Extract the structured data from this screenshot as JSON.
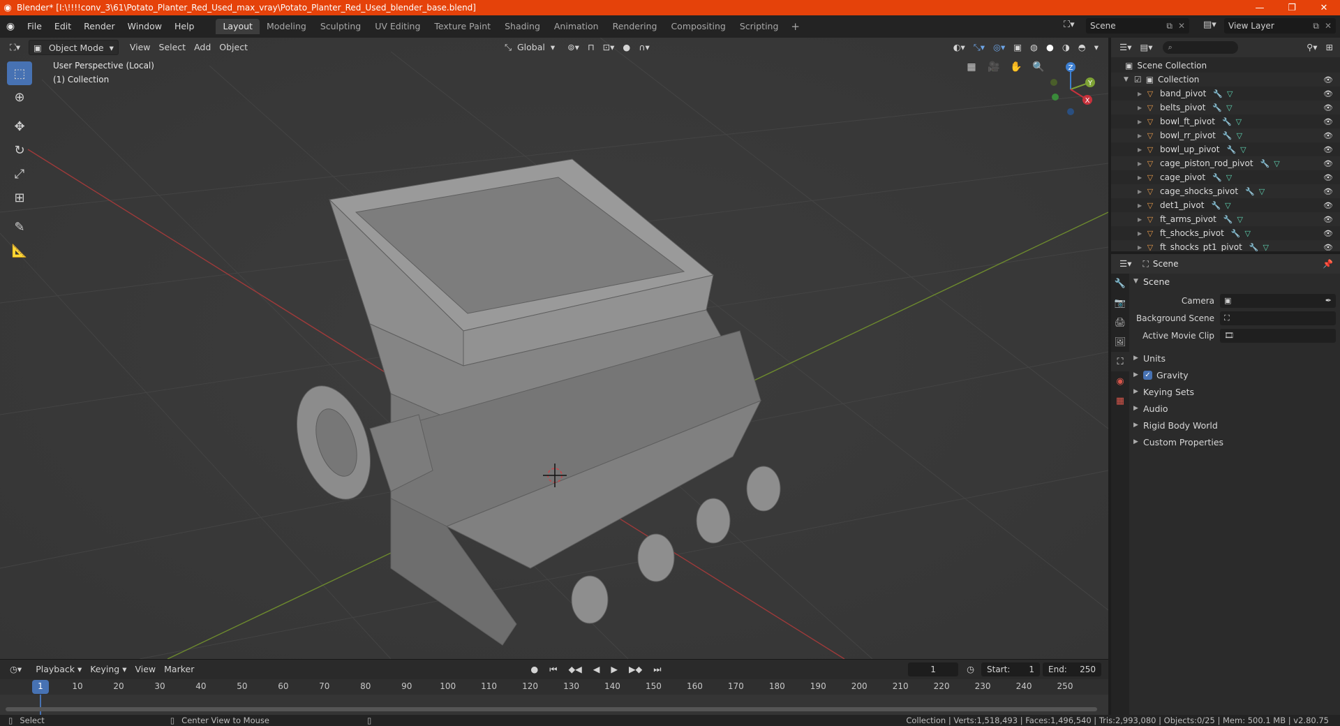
{
  "window": {
    "title": "Blender* [I:\\!!!!conv_3\\61\\Potato_Planter_Red_Used_max_vray\\Potato_Planter_Red_Used_blender_base.blend]",
    "minimize": "—",
    "maximize": "❐",
    "close": "✕"
  },
  "menu": [
    "File",
    "Edit",
    "Render",
    "Window",
    "Help"
  ],
  "workspaces": [
    "Layout",
    "Modeling",
    "Sculpting",
    "UV Editing",
    "Texture Paint",
    "Shading",
    "Animation",
    "Rendering",
    "Compositing",
    "Scripting"
  ],
  "active_workspace": "Layout",
  "scene_name": "Scene",
  "view_layer": "View Layer",
  "viewport": {
    "mode": "Object Mode",
    "menus": [
      "View",
      "Select",
      "Add",
      "Object"
    ],
    "orientation": "Global",
    "info_line1": "User Perspective (Local)",
    "info_line2": "(1) Collection",
    "gizmo": {
      "x": "X",
      "y": "Y",
      "z": "Z"
    }
  },
  "timeline": {
    "menus": [
      "Playback",
      "Keying",
      "View",
      "Marker"
    ],
    "current_frame": "1",
    "start_label": "Start:",
    "start": "1",
    "end_label": "End:",
    "end": "250",
    "ticks": [
      "1",
      "10",
      "20",
      "30",
      "40",
      "50",
      "60",
      "70",
      "80",
      "90",
      "100",
      "110",
      "120",
      "130",
      "140",
      "150",
      "160",
      "170",
      "180",
      "190",
      "200",
      "210",
      "220",
      "230",
      "240",
      "250"
    ]
  },
  "statusbar": {
    "select": "Select",
    "center_view": "Center View to Mouse",
    "stats": "Collection | Verts:1,518,493 | Faces:1,496,540 | Tris:2,993,080 | Objects:0/25 | Mem: 500.1 MB | v2.80.75"
  },
  "outliner": {
    "root": "Scene Collection",
    "collection": "Collection",
    "items": [
      "band_pivot",
      "belts_pivot",
      "bowl_ft_pivot",
      "bowl_rr_pivot",
      "bowl_up_pivot",
      "cage_piston_rod_pivot",
      "cage_pivot",
      "cage_shocks_pivot",
      "det1_pivot",
      "ft_arms_pivot",
      "ft_shocks_pivot",
      "ft_shocks_pt1_pivot"
    ]
  },
  "properties": {
    "context": "Scene",
    "panel": "Scene",
    "camera_label": "Camera",
    "background_scene_label": "Background Scene",
    "active_movie_clip_label": "Active Movie Clip",
    "subpanels": [
      "Units",
      "Gravity",
      "Keying Sets",
      "Audio",
      "Rigid Body World",
      "Custom Properties"
    ]
  },
  "colors": {
    "titlebar": "#e5420a",
    "accent": "#4772b3",
    "viewport_bg": "#3a3a3a",
    "x_axis": "#c8323c",
    "y_axis": "#7ea235",
    "z_axis": "#3d7fd1"
  }
}
